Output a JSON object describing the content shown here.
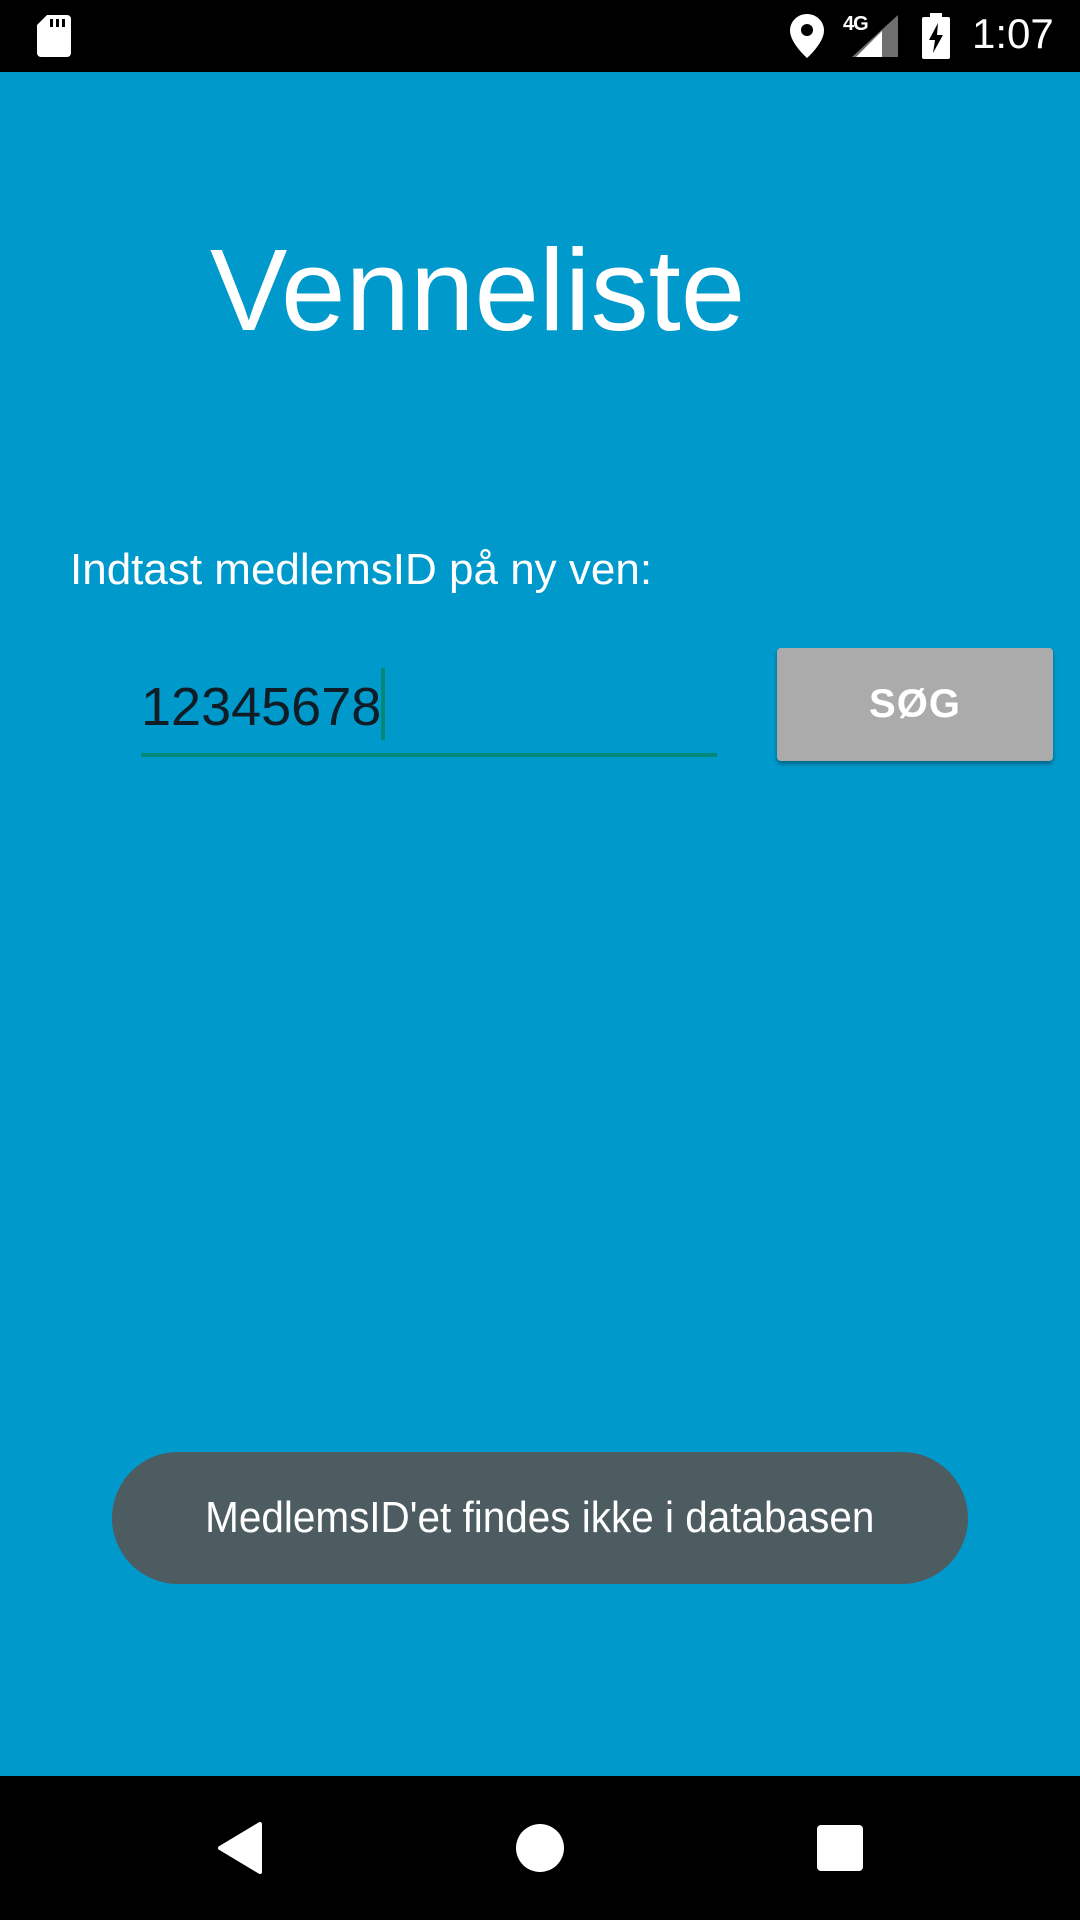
{
  "status_bar": {
    "network": "4G",
    "time": "1:07",
    "icons": [
      "sd-card-icon",
      "location-icon",
      "signal-icon",
      "battery-charging-icon"
    ]
  },
  "app": {
    "title": "Venneliste",
    "prompt": "Indtast medlemsID på ny ven:",
    "member_id_input": {
      "value": "12345678",
      "placeholder": ""
    },
    "search_button_label": "SØG"
  },
  "toast": {
    "message": "MedlemsID'et findes ikke i databasen"
  },
  "navigation_bar": {
    "icons": [
      "back-icon",
      "home-icon",
      "recents-icon"
    ]
  },
  "colors": {
    "background": "#0099cc",
    "accent": "#00897b",
    "button": "#ababab",
    "toast": "#4d5c61"
  }
}
